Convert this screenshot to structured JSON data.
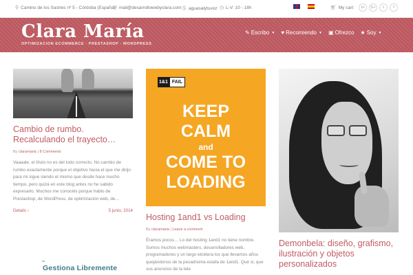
{
  "topbar": {
    "address": "Camino de los Sastres nº 5 - Córdoba (España)",
    "email": "mail@desarrollowebyclara.com",
    "skype": "aguasalytuvoz",
    "hours": "L-V: 10 - 18h",
    "cart_label": "My cart",
    "social": [
      "in",
      "G+",
      "t",
      "f"
    ]
  },
  "header": {
    "logo_title": "Clara María",
    "logo_subtitle": "OPTIMIZACION ECOMMERCE · PRESTASHOP · WORDPRESS",
    "nav": [
      {
        "label": "Escribo",
        "icon": "pencil-icon"
      },
      {
        "label": "Recomiendo",
        "icon": "heart-icon"
      },
      {
        "label": "Ofrezco",
        "icon": "bag-icon"
      },
      {
        "label": "Soy",
        "icon": "star-icon"
      }
    ]
  },
  "posts": [
    {
      "title": "Cambio de rumbo. Recalculando el trayecto…",
      "author": "clararnaria",
      "comments": "8 Comments",
      "excerpt": "Vaaaale, el título no es del todo correcto. No cambio de rumbo exactamente porque el objetivo hacia el que me dirijo para mi sigue siendo el mismo que desde hace mucho tiempo, pero quizá en este blog antes no he sabido expresarlo. Muchos me conocéis porque hablo de Prestashop, de WordPress, de optimización web, de…",
      "details_label": "Details",
      "date": "5 junio, 2014"
    },
    {
      "title": "Hosting 1and1 vs Loading",
      "author": "clararnaria",
      "comments": "Leave a comment",
      "excerpt": "Éramos pocos… Lo del hosting 1and1 no tiene nombre. Somos muchos webmasters, desarrolladores web, programadores y un largo etcétera los que llevamos años quejándonos de la pesadísima estafa de 1and1. Qué si, que sus anuncios de la tele",
      "image": {
        "badge_left": "1&1",
        "badge_right": "FAIL",
        "line1": "KEEP",
        "line2": "CALM",
        "line3": "and",
        "line4": "COME TO",
        "line5": "LOADING"
      }
    },
    {
      "title": "Demonbela: diseño, grafismo, ilustración y objetos personalizados"
    }
  ],
  "next_post_teaser": "Gestiona Libremente",
  "colors": {
    "accent": "#c05b62",
    "header_bg": "#c05b62",
    "keep_calm_bg": "#f5a623"
  }
}
